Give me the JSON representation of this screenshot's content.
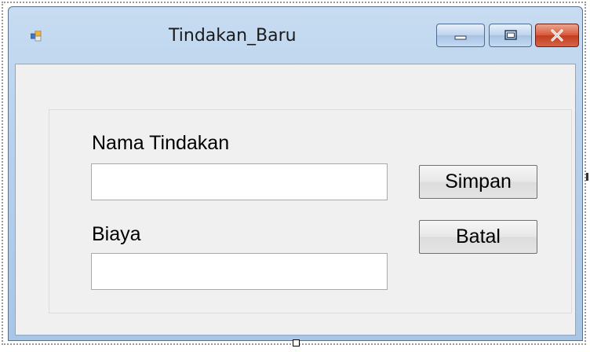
{
  "window": {
    "title": "Tindakan_Baru",
    "icon": "form-icon",
    "controls": {
      "minimize_icon": "minimize-icon",
      "maximize_icon": "maximize-icon",
      "close_icon": "close-icon"
    }
  },
  "form": {
    "nama_label": "Nama Tindakan",
    "nama_value": "",
    "biaya_label": "Biaya",
    "biaya_value": "",
    "simpan_label": "Simpan",
    "batal_label": "Batal"
  },
  "colors": {
    "client_background": "#f0f0f0",
    "close_button": "#c23c1f",
    "title_bar": "#b8d1ec"
  }
}
